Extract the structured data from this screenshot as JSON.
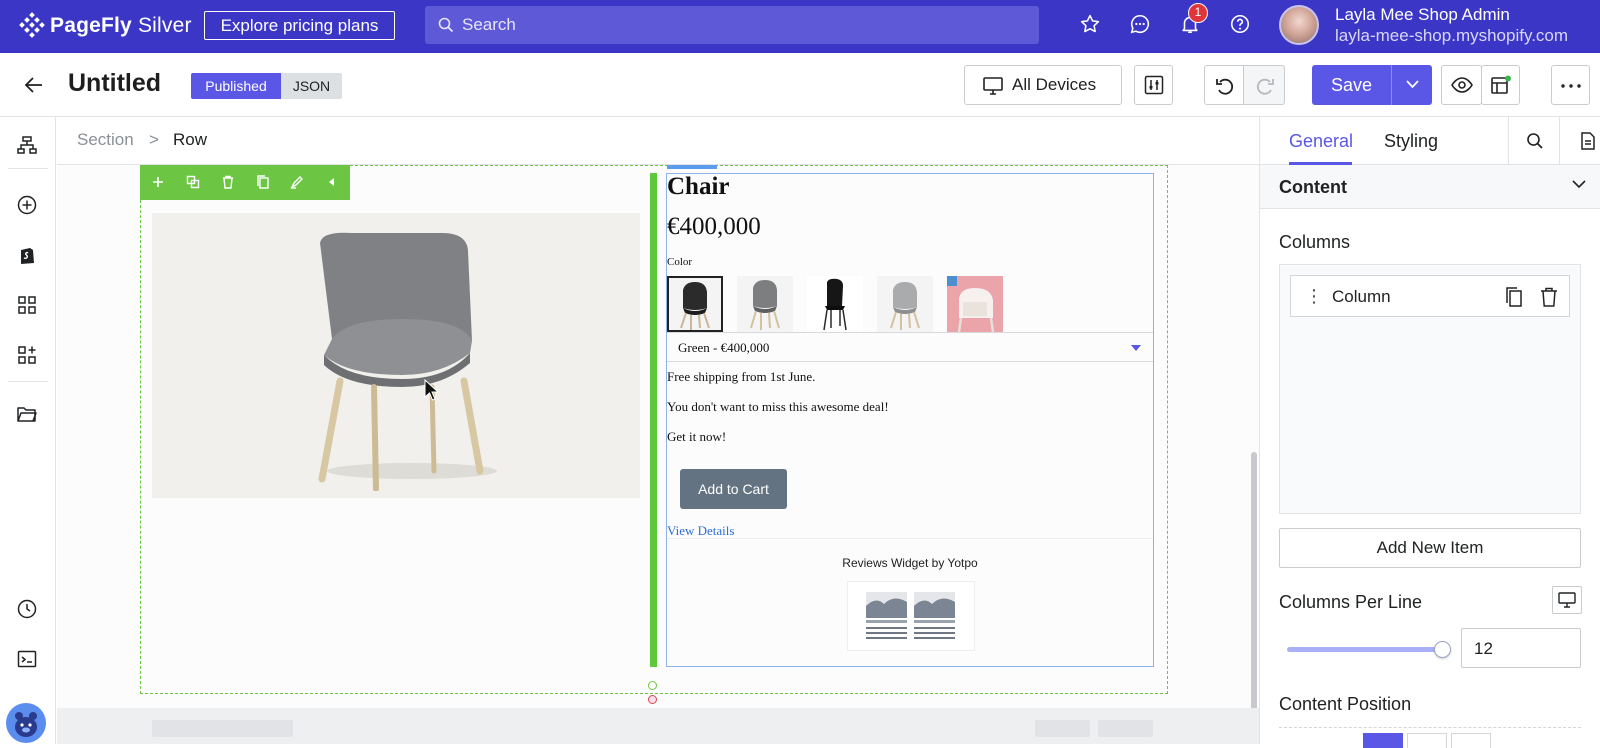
{
  "app": {
    "brand": "PageFly",
    "plan": "Silver",
    "pricing_link": "Explore pricing plans",
    "search_placeholder": "Search",
    "notification_count": "1",
    "user_name": "Layla Mee Shop Admin",
    "user_domain": "layla-mee-shop.myshopify.com",
    "accent": "#3b36c6"
  },
  "toolbar": {
    "page_title": "Untitled",
    "status": "Published",
    "format": "JSON",
    "devices_label": "All Devices",
    "save_label": "Save"
  },
  "breadcrumb": {
    "section": "Section",
    "separator": ">",
    "row": "Row"
  },
  "product": {
    "title": "Chair",
    "price": "€400,000",
    "color_label": "Color",
    "swatches": [
      "grey-black-chair",
      "grey-chair",
      "black-chair",
      "light-grey-chair",
      "pink-chair"
    ],
    "variant": "Green - €400,000",
    "description": [
      "Free shipping from 1st June.",
      "You don't want to miss this awesome deal!",
      "Get it now!"
    ],
    "add_to_cart": "Add to Cart",
    "view_details": "View Details",
    "reviews_title": "Reviews Widget by Yotpo"
  },
  "panel": {
    "tab_general": "General",
    "tab_styling": "Styling",
    "content_title": "Content",
    "columns_label": "Columns",
    "column_item": "Column",
    "add_item": "Add New Item",
    "columns_per_line_label": "Columns Per Line",
    "columns_per_line_value": "12",
    "content_position_label": "Content Position"
  }
}
